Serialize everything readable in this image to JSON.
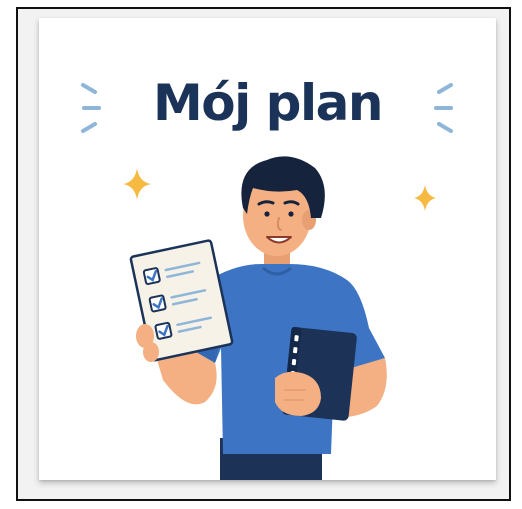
{
  "poster": {
    "title": "Mój plan"
  },
  "colors": {
    "title_navy": "#1b3358",
    "shirt_blue": "#3d75c4",
    "skin": "#f4b083",
    "hair": "#15233d",
    "pants": "#1c3257",
    "accent_yellow": "#f6b942",
    "accent_lightblue": "#8fb5d9",
    "checklist_paper": "#f6f2e8",
    "notebook": "#1c3257"
  },
  "icons": [
    "sparkle-icon",
    "checkbox-checked-icon",
    "notebook-icon"
  ]
}
